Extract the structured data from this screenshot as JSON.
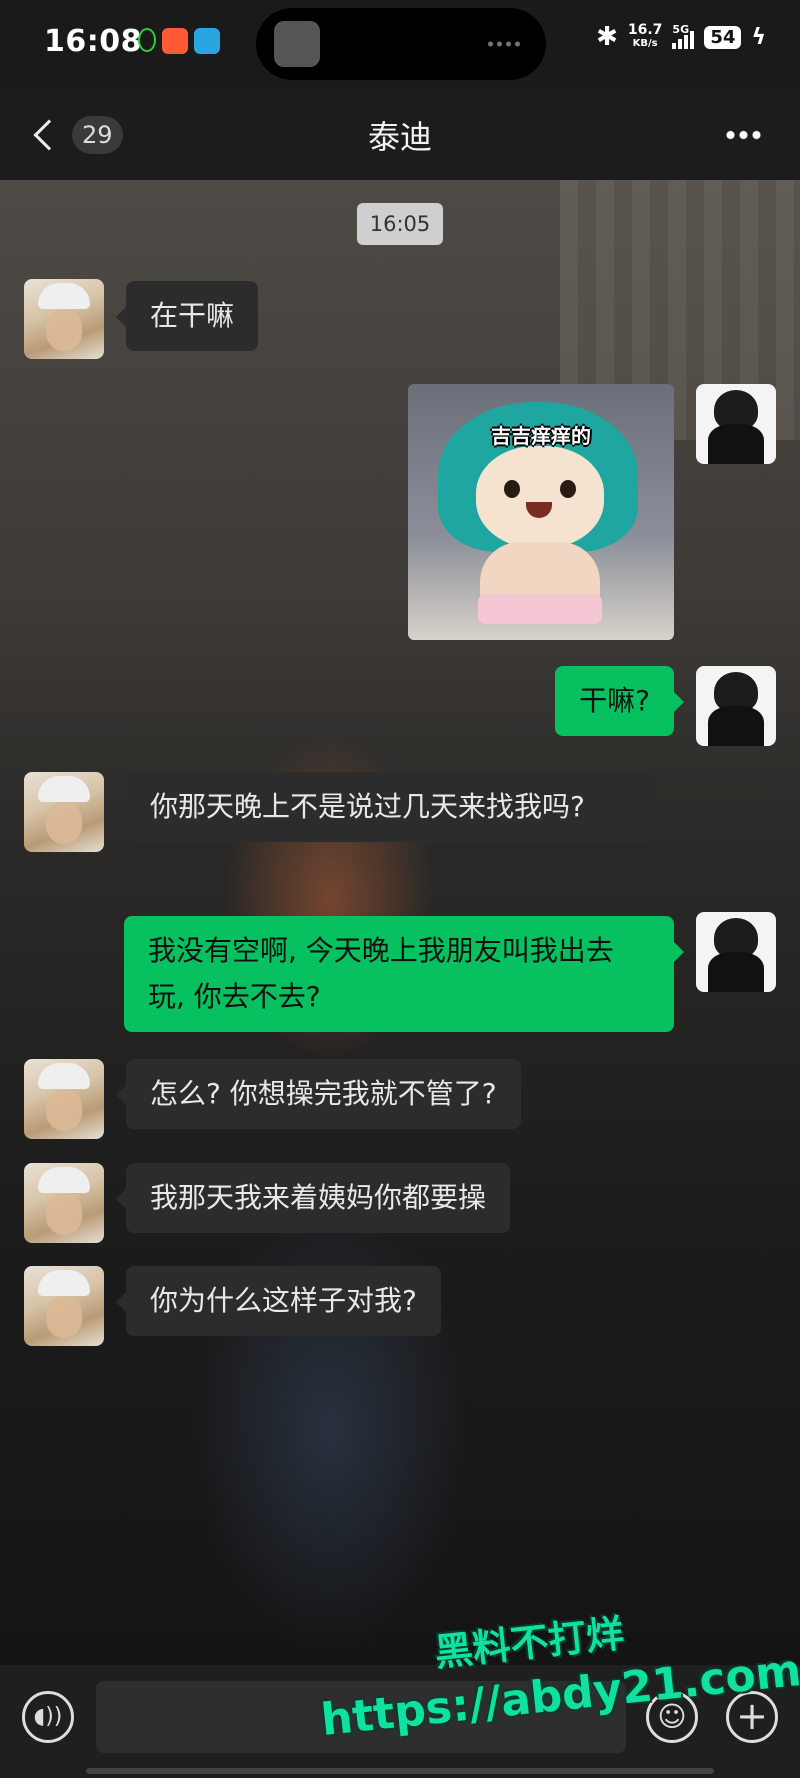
{
  "status_bar": {
    "time": "16:08",
    "net_speed_value": "16.7",
    "net_speed_unit": "KB/s",
    "network_type": "5G",
    "battery": "54"
  },
  "header": {
    "unread_count": "29",
    "title": "泰迪",
    "back_icon": "chevron-left-icon",
    "more_icon": "more-dots-icon"
  },
  "chat": {
    "timestamp": "16:05",
    "sticker_caption": "吉吉痒痒的",
    "messages": [
      {
        "side": "in",
        "text": "在干嘛"
      },
      {
        "side": "out",
        "type": "sticker"
      },
      {
        "side": "out",
        "text": "干嘛?"
      },
      {
        "side": "in",
        "text": "你那天晚上不是说过几天来找我吗?"
      },
      {
        "side": "out",
        "text": "我没有空啊, 今天晚上我朋友叫我出去玩, 你去不去?"
      },
      {
        "side": "in",
        "text": "怎么? 你想操完我就不管了?"
      },
      {
        "side": "in",
        "text": "我那天我来着姨妈你都要操"
      },
      {
        "side": "in",
        "text": "你为什么这样子对我?"
      }
    ]
  },
  "input_bar": {
    "voice_icon": "voice-icon",
    "emoji_icon": "emoji-icon",
    "plus_icon": "plus-icon"
  },
  "watermark": {
    "line1": "黑料不打烊",
    "line2": "https://abdy21.com"
  },
  "colors": {
    "outgoing_bubble": "#07c160",
    "incoming_bubble": "#2c2c2c",
    "header_bg": "#1c1c1c",
    "watermark": "#10e0a0"
  }
}
